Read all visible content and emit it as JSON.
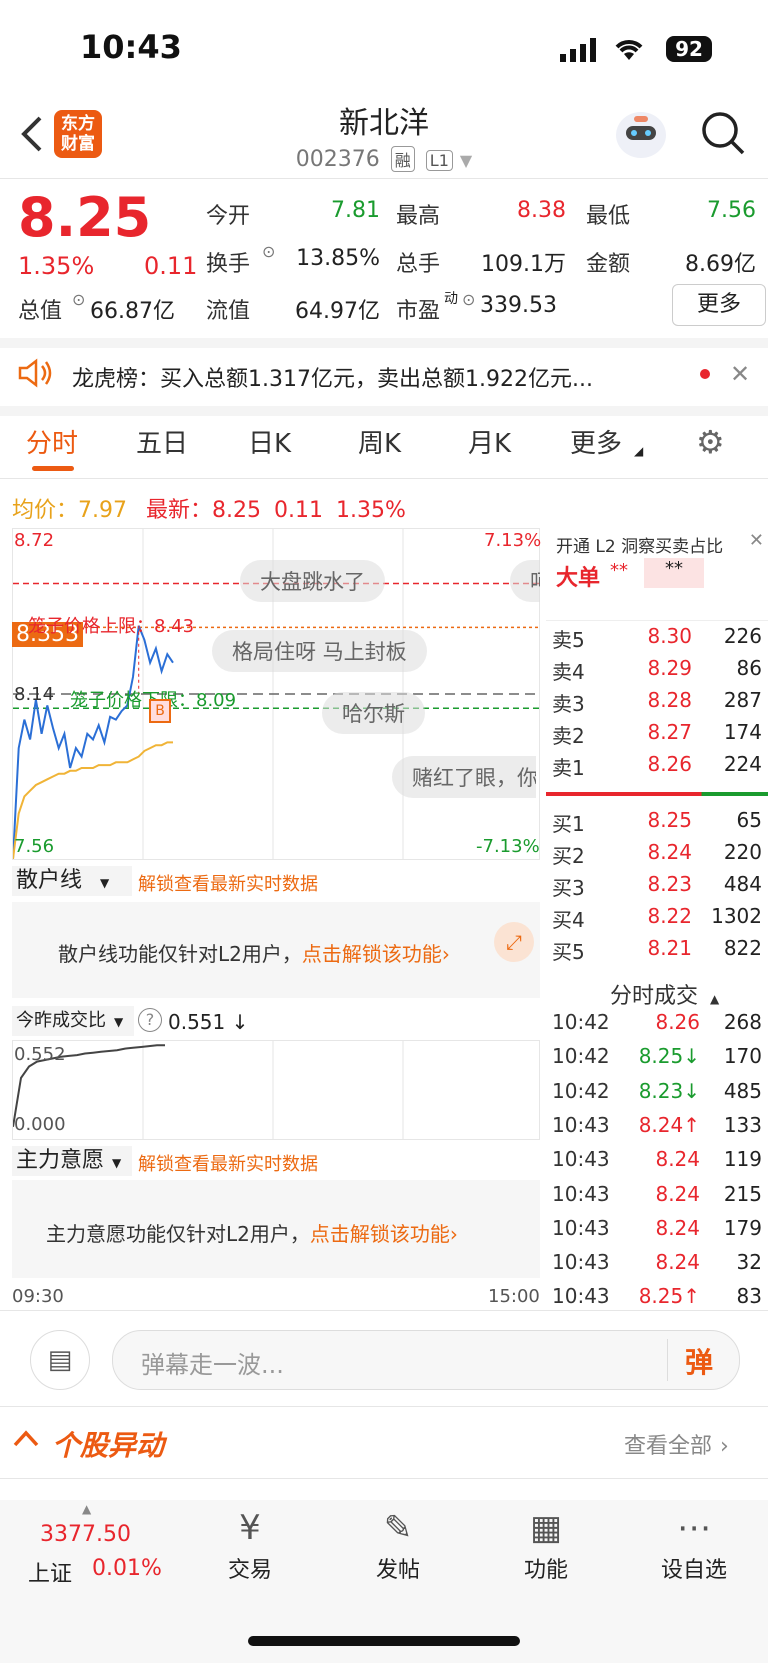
{
  "status": {
    "time": "10:43",
    "battery": "92"
  },
  "header": {
    "logo_line1": "东方",
    "logo_line2": "财富",
    "name": "新北洋",
    "code": "002376",
    "tag_margin": "融",
    "tag_level": "L1"
  },
  "quote": {
    "price": "8.25",
    "pct": "1.35%",
    "change": "0.11",
    "open_label": "今开",
    "open": "7.81",
    "high_label": "最高",
    "high": "8.38",
    "low_label": "最低",
    "low": "7.56",
    "turnover_label": "换手",
    "turnover": "13.85%",
    "volume_label": "总手",
    "volume": "109.1万",
    "amount_label": "金额",
    "amount": "8.69亿",
    "mktcap_label": "总值",
    "mktcap": "66.87亿",
    "float_label": "流值",
    "float_cap": "64.97亿",
    "pe_label": "市盈",
    "pe_sup": "动",
    "pe": "339.53",
    "more_btn": "更多"
  },
  "notice": {
    "text": "龙虎榜：买入总额1.317亿元，卖出总额1.922亿元..."
  },
  "tabs": [
    "分时",
    "五日",
    "日K",
    "周K",
    "月K",
    "更多"
  ],
  "chart_info": {
    "avg_label": "均价：",
    "avg": "7.97",
    "latest_label": "最新：",
    "latest": "8.25",
    "chg": "0.11",
    "pct": "1.35%"
  },
  "chart": {
    "y_top": "8.72",
    "y_bottom": "7.56",
    "pct_top": "7.13%",
    "pct_bottom": "-7.13%",
    "mid_price": "8.14",
    "cursor_price": "8.353",
    "upper_limit": "笼子价格上限：8.43",
    "lower_limit": "笼子价格下限：8.09",
    "time_start": "09:30",
    "time_end": "15:00",
    "danmu": [
      "大盘跳水了",
      "格局住呀 马上封板",
      "哈尔斯",
      "赌红了眼，你",
      "呵"
    ],
    "buy_marker": "B"
  },
  "chart_data": {
    "type": "line",
    "title": "",
    "ylim": [
      7.56,
      8.72
    ],
    "xlabel": "",
    "ylabel": "",
    "x_range": [
      "09:30",
      "15:00"
    ],
    "series": [
      {
        "values": [
          7.56,
          7.95,
          8.05,
          7.98,
          8.12,
          8.0,
          8.1,
          8.02,
          7.95,
          8.0,
          7.88,
          7.95,
          7.92,
          8.0,
          7.98,
          8.03,
          7.97,
          8.06,
          8.05,
          8.08,
          8.1,
          8.2,
          8.38,
          8.33,
          8.25,
          8.3,
          8.22,
          8.28,
          8.25
        ]
      },
      {
        "values": [
          7.56,
          7.72,
          7.78,
          7.8,
          7.82,
          7.83,
          7.84,
          7.85,
          7.86,
          7.86,
          7.87,
          7.87,
          7.88,
          7.88,
          7.88,
          7.89,
          7.89,
          7.89,
          7.9,
          7.9,
          7.9,
          7.91,
          7.92,
          7.94,
          7.95,
          7.96,
          7.96,
          7.97,
          7.97
        ]
      }
    ]
  },
  "l2": {
    "title": "开通 L2 洞察买卖占比",
    "big_order": "大单",
    "stars1": "**",
    "stars2": "**"
  },
  "asks": [
    {
      "label": "卖5",
      "price": "8.30",
      "vol": "226"
    },
    {
      "label": "卖4",
      "price": "8.29",
      "vol": "86"
    },
    {
      "label": "卖3",
      "price": "8.28",
      "vol": "287"
    },
    {
      "label": "卖2",
      "price": "8.27",
      "vol": "174"
    },
    {
      "label": "卖1",
      "price": "8.26",
      "vol": "224"
    }
  ],
  "bids": [
    {
      "label": "买1",
      "price": "8.25",
      "vol": "65"
    },
    {
      "label": "买2",
      "price": "8.24",
      "vol": "220"
    },
    {
      "label": "买3",
      "price": "8.23",
      "vol": "484"
    },
    {
      "label": "买4",
      "price": "8.22",
      "vol": "1302"
    },
    {
      "label": "买5",
      "price": "8.21",
      "vol": "822"
    }
  ],
  "trades_title": "分时成交",
  "trades": [
    {
      "time": "10:42",
      "price": "8.26",
      "vol": "268",
      "arrow": "",
      "color": "#e8262d"
    },
    {
      "time": "10:42",
      "price": "8.25↓",
      "vol": "170",
      "arrow": "",
      "color": "#1a9b2e"
    },
    {
      "time": "10:42",
      "price": "8.23↓",
      "vol": "485",
      "arrow": "",
      "color": "#1a9b2e"
    },
    {
      "time": "10:43",
      "price": "8.24↑",
      "vol": "133",
      "arrow": "",
      "color": "#e8262d"
    },
    {
      "time": "10:43",
      "price": "8.24",
      "vol": "119",
      "arrow": "",
      "color": "#e8262d"
    },
    {
      "time": "10:43",
      "price": "8.24",
      "vol": "215",
      "arrow": "",
      "color": "#e8262d"
    },
    {
      "time": "10:43",
      "price": "8.24",
      "vol": "179",
      "arrow": "",
      "color": "#e8262d"
    },
    {
      "time": "10:43",
      "price": "8.24",
      "vol": "32",
      "arrow": "",
      "color": "#e8262d"
    },
    {
      "time": "10:43",
      "price": "8.25↑",
      "vol": "83",
      "arrow": "",
      "color": "#e8262d"
    }
  ],
  "retail": {
    "selector": "散户线",
    "unlock_link": "解锁查看最新实时数据",
    "msg": "散户线功能仅针对L2用户，",
    "msg_link": "点击解锁该功能"
  },
  "ratio": {
    "selector": "今昨成交比",
    "value": "0.551 ↓",
    "top": "0.552",
    "bottom": "0.000"
  },
  "main_force": {
    "selector": "主力意愿",
    "unlock_link": "解锁查看最新实时数据",
    "msg": "主力意愿功能仅针对L2用户，",
    "msg_link": "点击解锁该功能"
  },
  "danmu_bar": {
    "placeholder": "弹幕走一波...",
    "send": "弹"
  },
  "movement": {
    "title": "个股异动",
    "view_all": "查看全部"
  },
  "nav": {
    "index_value": "3377.50",
    "index_name": "上证",
    "index_pct": "0.01%",
    "items": [
      {
        "label": "交易"
      },
      {
        "label": "发帖"
      },
      {
        "label": "功能"
      },
      {
        "label": "设自选"
      }
    ]
  }
}
